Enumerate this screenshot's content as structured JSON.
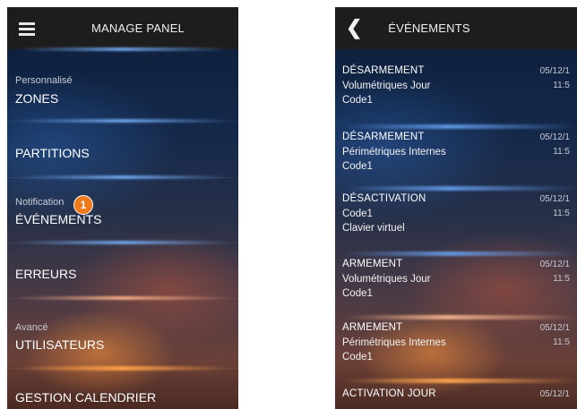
{
  "left_screen": {
    "header_title": "MANAGE PANEL",
    "items": [
      {
        "sub": "Personnalisé",
        "label": "ZONES"
      },
      {
        "sub": "",
        "label": "PARTITIONS"
      },
      {
        "sub": "Notification",
        "label": "ÉVÉNEMENTS",
        "badge": "1"
      },
      {
        "sub": "",
        "label": "ERREURS"
      },
      {
        "sub": "Avancé",
        "label": "UTILISATEURS"
      },
      {
        "sub": "",
        "label": "GESTION CALENDRIER"
      }
    ]
  },
  "right_screen": {
    "header_title": "ÉVÉNEMENTS",
    "events": [
      {
        "type": "DÉSARMEMENT",
        "line2": "Volumétriques Jour",
        "line3": "Code1",
        "date": "05/12/1",
        "time": "11:5"
      },
      {
        "type": "DÉSARMEMENT",
        "line2": "Périmétriques Internes",
        "line3": "Code1",
        "date": "05/12/1",
        "time": "11:5"
      },
      {
        "type": "DÉSACTIVATION",
        "line2": "Code1",
        "line3": "Clavier virtuel",
        "date": "05/12/1",
        "time": "11:5"
      },
      {
        "type": "ARMEMENT",
        "line2": "Volumétriques Jour",
        "line3": "Code1",
        "date": "05/12/1",
        "time": "11:5"
      },
      {
        "type": "ARMEMENT",
        "line2": "Périmétriques Internes",
        "line3": "Code1",
        "date": "05/12/1",
        "time": "11:5"
      },
      {
        "type": "ACTIVATION JOUR",
        "line2": "",
        "line3": "",
        "date": "05/12/1",
        "time": ""
      }
    ]
  }
}
